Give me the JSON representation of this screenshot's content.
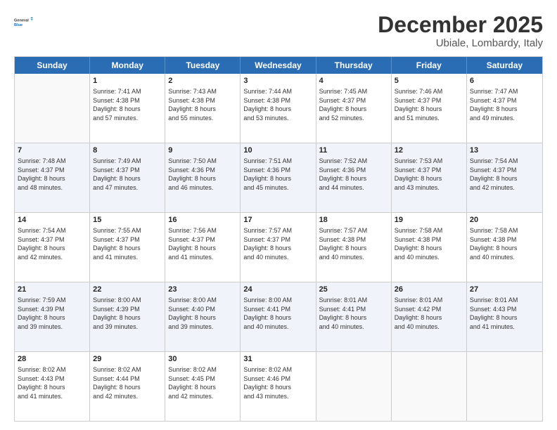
{
  "header": {
    "logo_line1": "General",
    "logo_line2": "Blue",
    "month_title": "December 2025",
    "location": "Ubiale, Lombardy, Italy"
  },
  "days_of_week": [
    "Sunday",
    "Monday",
    "Tuesday",
    "Wednesday",
    "Thursday",
    "Friday",
    "Saturday"
  ],
  "weeks": [
    {
      "alt": false,
      "cells": [
        {
          "day": "",
          "info": ""
        },
        {
          "day": "1",
          "info": "Sunrise: 7:41 AM\nSunset: 4:38 PM\nDaylight: 8 hours\nand 57 minutes."
        },
        {
          "day": "2",
          "info": "Sunrise: 7:43 AM\nSunset: 4:38 PM\nDaylight: 8 hours\nand 55 minutes."
        },
        {
          "day": "3",
          "info": "Sunrise: 7:44 AM\nSunset: 4:38 PM\nDaylight: 8 hours\nand 53 minutes."
        },
        {
          "day": "4",
          "info": "Sunrise: 7:45 AM\nSunset: 4:37 PM\nDaylight: 8 hours\nand 52 minutes."
        },
        {
          "day": "5",
          "info": "Sunrise: 7:46 AM\nSunset: 4:37 PM\nDaylight: 8 hours\nand 51 minutes."
        },
        {
          "day": "6",
          "info": "Sunrise: 7:47 AM\nSunset: 4:37 PM\nDaylight: 8 hours\nand 49 minutes."
        }
      ]
    },
    {
      "alt": true,
      "cells": [
        {
          "day": "7",
          "info": "Sunrise: 7:48 AM\nSunset: 4:37 PM\nDaylight: 8 hours\nand 48 minutes."
        },
        {
          "day": "8",
          "info": "Sunrise: 7:49 AM\nSunset: 4:37 PM\nDaylight: 8 hours\nand 47 minutes."
        },
        {
          "day": "9",
          "info": "Sunrise: 7:50 AM\nSunset: 4:36 PM\nDaylight: 8 hours\nand 46 minutes."
        },
        {
          "day": "10",
          "info": "Sunrise: 7:51 AM\nSunset: 4:36 PM\nDaylight: 8 hours\nand 45 minutes."
        },
        {
          "day": "11",
          "info": "Sunrise: 7:52 AM\nSunset: 4:36 PM\nDaylight: 8 hours\nand 44 minutes."
        },
        {
          "day": "12",
          "info": "Sunrise: 7:53 AM\nSunset: 4:37 PM\nDaylight: 8 hours\nand 43 minutes."
        },
        {
          "day": "13",
          "info": "Sunrise: 7:54 AM\nSunset: 4:37 PM\nDaylight: 8 hours\nand 42 minutes."
        }
      ]
    },
    {
      "alt": false,
      "cells": [
        {
          "day": "14",
          "info": "Sunrise: 7:54 AM\nSunset: 4:37 PM\nDaylight: 8 hours\nand 42 minutes."
        },
        {
          "day": "15",
          "info": "Sunrise: 7:55 AM\nSunset: 4:37 PM\nDaylight: 8 hours\nand 41 minutes."
        },
        {
          "day": "16",
          "info": "Sunrise: 7:56 AM\nSunset: 4:37 PM\nDaylight: 8 hours\nand 41 minutes."
        },
        {
          "day": "17",
          "info": "Sunrise: 7:57 AM\nSunset: 4:37 PM\nDaylight: 8 hours\nand 40 minutes."
        },
        {
          "day": "18",
          "info": "Sunrise: 7:57 AM\nSunset: 4:38 PM\nDaylight: 8 hours\nand 40 minutes."
        },
        {
          "day": "19",
          "info": "Sunrise: 7:58 AM\nSunset: 4:38 PM\nDaylight: 8 hours\nand 40 minutes."
        },
        {
          "day": "20",
          "info": "Sunrise: 7:58 AM\nSunset: 4:38 PM\nDaylight: 8 hours\nand 40 minutes."
        }
      ]
    },
    {
      "alt": true,
      "cells": [
        {
          "day": "21",
          "info": "Sunrise: 7:59 AM\nSunset: 4:39 PM\nDaylight: 8 hours\nand 39 minutes."
        },
        {
          "day": "22",
          "info": "Sunrise: 8:00 AM\nSunset: 4:39 PM\nDaylight: 8 hours\nand 39 minutes."
        },
        {
          "day": "23",
          "info": "Sunrise: 8:00 AM\nSunset: 4:40 PM\nDaylight: 8 hours\nand 39 minutes."
        },
        {
          "day": "24",
          "info": "Sunrise: 8:00 AM\nSunset: 4:41 PM\nDaylight: 8 hours\nand 40 minutes."
        },
        {
          "day": "25",
          "info": "Sunrise: 8:01 AM\nSunset: 4:41 PM\nDaylight: 8 hours\nand 40 minutes."
        },
        {
          "day": "26",
          "info": "Sunrise: 8:01 AM\nSunset: 4:42 PM\nDaylight: 8 hours\nand 40 minutes."
        },
        {
          "day": "27",
          "info": "Sunrise: 8:01 AM\nSunset: 4:43 PM\nDaylight: 8 hours\nand 41 minutes."
        }
      ]
    },
    {
      "alt": false,
      "cells": [
        {
          "day": "28",
          "info": "Sunrise: 8:02 AM\nSunset: 4:43 PM\nDaylight: 8 hours\nand 41 minutes."
        },
        {
          "day": "29",
          "info": "Sunrise: 8:02 AM\nSunset: 4:44 PM\nDaylight: 8 hours\nand 42 minutes."
        },
        {
          "day": "30",
          "info": "Sunrise: 8:02 AM\nSunset: 4:45 PM\nDaylight: 8 hours\nand 42 minutes."
        },
        {
          "day": "31",
          "info": "Sunrise: 8:02 AM\nSunset: 4:46 PM\nDaylight: 8 hours\nand 43 minutes."
        },
        {
          "day": "",
          "info": ""
        },
        {
          "day": "",
          "info": ""
        },
        {
          "day": "",
          "info": ""
        }
      ]
    }
  ]
}
